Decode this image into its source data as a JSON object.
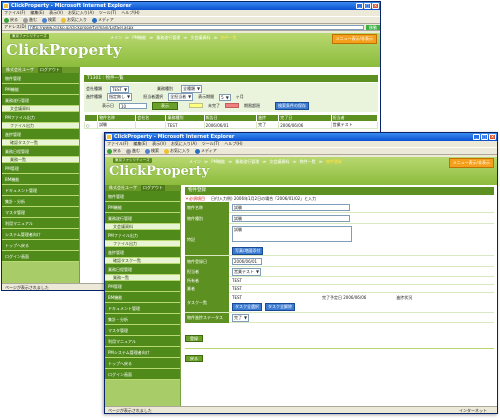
{
  "back_window": {
    "title": "ClickProperty - Microsoft Internet Explorer",
    "menu": [
      "ファイル(F)",
      "編集(E)",
      "表示(V)",
      "お気に入り(A)",
      "ツール(T)",
      "ヘルプ(H)"
    ],
    "toolbar": [
      "戻る",
      "進む",
      "検索",
      "お気に入り",
      "メディア"
    ],
    "address_label": "アドレス(D)",
    "address_value": "http://www.clickp.jp/clickproperty/main/ListSel.aspx",
    "go": "移動",
    "logo_small": "東京ファシリティーズ",
    "logo": "ClickProperty",
    "crumbs": [
      "メイン",
      "PM機能",
      "業務遂行管理",
      "文会議資料",
      "物件一覧"
    ],
    "menu_button": "メニュー表示/非表示",
    "user_label": "株式会社ユーザ",
    "logout": "ログアウト",
    "sidebar": [
      {
        "type": "item",
        "label": "物件管理"
      },
      {
        "type": "item",
        "label": "PM機能"
      },
      {
        "type": "item",
        "label": "業務遂行管理"
      },
      {
        "type": "sub",
        "label": "文会議資料"
      },
      {
        "type": "item",
        "label": "PMファイル出力"
      },
      {
        "type": "sub",
        "label": "ファイル出力"
      },
      {
        "type": "item",
        "label": "進捗管理"
      },
      {
        "type": "sub",
        "label": "確認タスク一覧"
      },
      {
        "type": "item",
        "label": "業務日程管理"
      },
      {
        "type": "sub",
        "label": "業務一覧"
      },
      {
        "type": "item",
        "label": "PM管理"
      },
      {
        "type": "item",
        "label": "BM機能"
      },
      {
        "type": "item",
        "label": "ドキュメント管理"
      },
      {
        "type": "item",
        "label": "集計・分析"
      },
      {
        "type": "item",
        "label": "マスタ管理"
      },
      {
        "type": "item",
        "label": "利用マニュアル"
      },
      {
        "type": "item",
        "label": "システム管理者向け"
      },
      {
        "type": "item",
        "label": "トップへ戻る"
      },
      {
        "type": "item",
        "label": "ログイン画面"
      }
    ],
    "panel_title": "T1301 : 物件一覧",
    "filters": {
      "row1": [
        {
          "label": "会社種類",
          "value": "TEST"
        },
        {
          "label": "業務種別",
          "value": "全種類"
        }
      ],
      "row2": [
        {
          "label": "進捗種類",
          "value": "指定無し"
        },
        {
          "label": "担当者選択",
          "value": "全担当者"
        },
        {
          "label": "表示期間",
          "value": "5"
        }
      ],
      "period_suffix": "ヶ月",
      "row3_label": "表示日",
      "row3_value": "10",
      "display_btn": "表示",
      "legend_yellow": "未完了",
      "legend_red": "期限超過",
      "csv_btn": "検索条件の保存"
    },
    "table": {
      "headers": [
        "",
        "物件名称",
        "会社名",
        "業務種別",
        "報告日",
        "進捗",
        "完了日",
        "担当者"
      ],
      "rows": [
        [
          "○",
          "試験",
          "",
          "TEST",
          "2006/06/01",
          "完了",
          "2006/06/06",
          "営業テスト"
        ]
      ]
    },
    "status": "ページが表示されました"
  },
  "front_window": {
    "title": "ClickProperty - Microsoft Internet Explorer",
    "menu": [
      "ファイル(F)",
      "編集(E)",
      "表示(V)",
      "お気に入り(A)",
      "ツール(T)",
      "ヘルプ(H)"
    ],
    "toolbar": [
      "戻る",
      "進む",
      "検索",
      "お気に入り",
      "メディア"
    ],
    "logo_small": "東京ファシリティーズ",
    "logo": "ClickProperty",
    "crumbs": [
      "メイン",
      "PM機能",
      "業務遂行管理",
      "文会議資料",
      "物件一覧",
      "物件登録"
    ],
    "menu_button": "メニュー表示/非表示",
    "user_label": "株式会社ユーザ",
    "logout": "ログアウト",
    "sidebar": [
      {
        "type": "item",
        "label": "物件管理"
      },
      {
        "type": "item",
        "label": "PM機能"
      },
      {
        "type": "item",
        "label": "業務遂行管理"
      },
      {
        "type": "sub",
        "label": "文会議資料"
      },
      {
        "type": "item",
        "label": "PMファイル出力"
      },
      {
        "type": "sub",
        "label": "ファイル出力"
      },
      {
        "type": "item",
        "label": "進捗管理"
      },
      {
        "type": "sub",
        "label": "確認タスク一覧"
      },
      {
        "type": "item",
        "label": "業務日程管理"
      },
      {
        "type": "sub",
        "label": "業務一覧"
      },
      {
        "type": "item",
        "label": "PM管理"
      },
      {
        "type": "item",
        "label": "BM機能"
      },
      {
        "type": "item",
        "label": "ドキュメント管理"
      },
      {
        "type": "item",
        "label": "集計・分析"
      },
      {
        "type": "item",
        "label": "マスタ管理"
      },
      {
        "type": "item",
        "label": "利用マニュアル"
      },
      {
        "type": "item",
        "label": "PMシステム管理者向け"
      },
      {
        "type": "item",
        "label": "トップへ戻る"
      },
      {
        "type": "item",
        "label": "ログイン画面"
      }
    ],
    "form_title": "物件登録",
    "required_note": "＊必須項目",
    "info_text": "日付入力例) 2006年1月2日の場合「2006/01/02」と入力",
    "fields": {
      "name_label": "物件名称",
      "name_value": "試験",
      "class_label": "物件種別",
      "class_value": "試験",
      "memo_label": "特記",
      "memo_value": "試験",
      "attach_btn": "写真/地図添付",
      "date_label": "物件登録日",
      "date_value": "2006/06/01",
      "agent_label": "担当者",
      "agent_value": "営業テスト",
      "owner_label": "所有者",
      "owner_value": "TEST",
      "company_label": "業者",
      "company_value": "TEST",
      "task_label": "タスク一覧",
      "task_col1": "TEST",
      "task_col2": "完了予定日 2006/06/06",
      "task_col3": "進捗状況",
      "task_btn1": "タスク全選択",
      "task_btn2": "タスク全解除",
      "status_label": "物件進捗ステータス",
      "status_value": "完了"
    },
    "register_btn": "登録",
    "back_btn": "戻る",
    "status": "ページが表示されました",
    "zone": "インターネット"
  }
}
